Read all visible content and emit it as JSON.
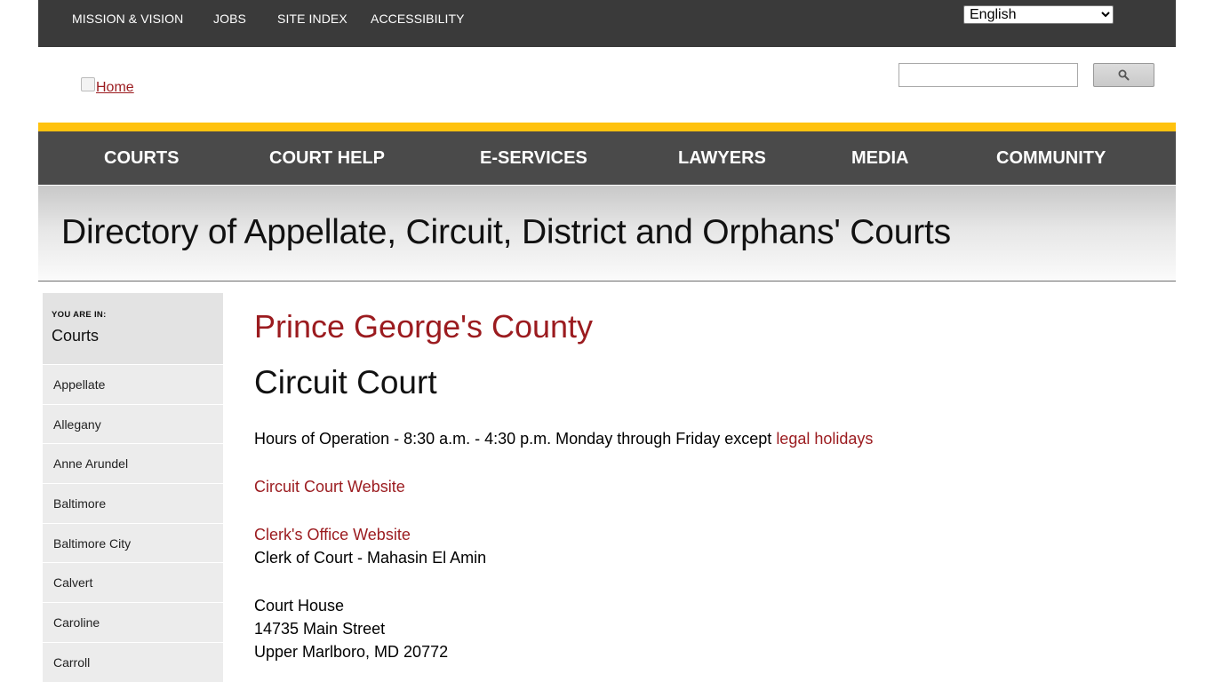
{
  "utility_nav": {
    "links": [
      "MISSION & VISION",
      "JOBS",
      "SITE INDEX",
      "ACCESSIBILITY"
    ],
    "language_selected": "English"
  },
  "header": {
    "logo_alt": "Home",
    "search_placeholder": ""
  },
  "main_nav": [
    "COURTS",
    "COURT HELP",
    "E-SERVICES",
    "LAWYERS",
    "MEDIA",
    "COMMUNITY"
  ],
  "banner": {
    "title": "Directory of Appellate, Circuit, District and Orphans' Courts"
  },
  "sidebar": {
    "you_are_in_label": "YOU ARE IN:",
    "section": "Courts",
    "items": [
      "Appellate",
      "Allegany",
      "Anne Arundel",
      "Baltimore",
      "Baltimore City",
      "Calvert",
      "Caroline",
      "Carroll"
    ]
  },
  "content": {
    "county": "Prince George's County",
    "court": "Circuit Court",
    "hours_text": "Hours of Operation - 8:30 a.m. - 4:30 p.m. Monday through Friday except",
    "hours_link": "legal holidays",
    "circuit_site_link": "Circuit Court Website",
    "clerk_site_link": "Clerk's Office Website",
    "clerk_text": "Clerk of Court - Mahasin El Amin",
    "address": {
      "name": "Court House",
      "street": "14735 Main Street",
      "city": "Upper Marlboro, MD 20772"
    }
  },
  "colors": {
    "utility_bg": "#3a3a3a",
    "accent_yellow": "#ffc20e",
    "nav_bg": "#4a4a4a",
    "link_red": "#9b1b1f"
  }
}
